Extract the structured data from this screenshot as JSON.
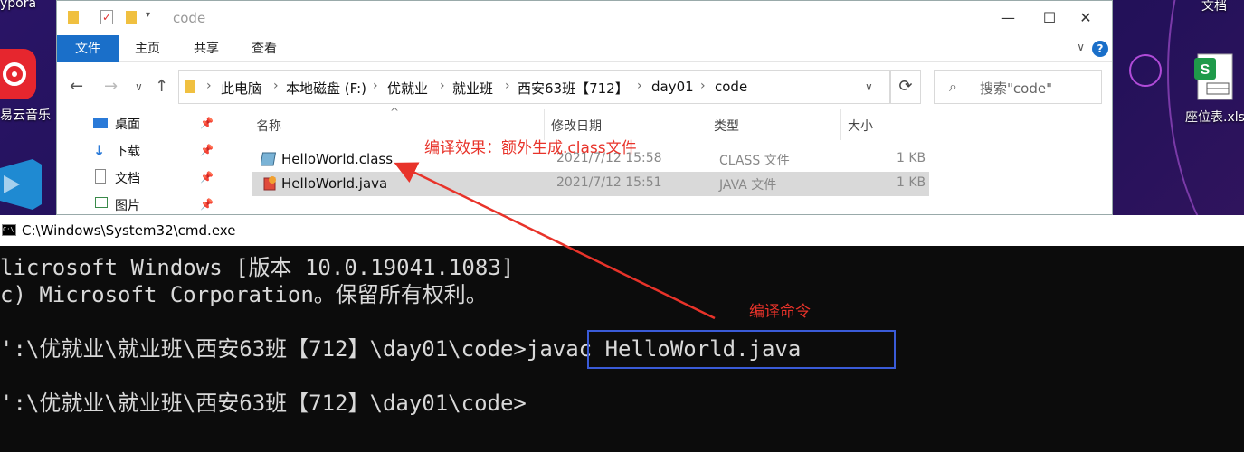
{
  "desktop": {
    "top_left_label": "ypora",
    "music_label": "易云音乐",
    "right_top_label": "文档",
    "sheet_label": "座位表.xls",
    "colors": {
      "accent_ring": "#b04bd8",
      "music_red": "#e6262e",
      "vscode_blue": "#1f8ad2"
    }
  },
  "explorer": {
    "window_title": "code",
    "ribbon": {
      "tabs": [
        "文件",
        "主页",
        "共享",
        "查看"
      ],
      "help": "?"
    },
    "breadcrumb": [
      "此电脑",
      "本地磁盘 (F:)",
      "优就业",
      "就业班",
      "西安63班【712】",
      "day01",
      "code"
    ],
    "search_placeholder": "搜索\"code\"",
    "nav_items": [
      "桌面",
      "下载",
      "文档",
      "图片"
    ],
    "columns": [
      "名称",
      "修改日期",
      "类型",
      "大小"
    ],
    "files": [
      {
        "name": "HelloWorld.class",
        "date": "2021/7/12 15:58",
        "type": "CLASS 文件",
        "size": "1 KB"
      },
      {
        "name": "HelloWorld.java",
        "date": "2021/7/12 15:51",
        "type": "JAVA 文件",
        "size": "1 KB"
      }
    ],
    "annotation": "编译效果：额外生成.class文件"
  },
  "cmd": {
    "title": "C:\\Windows\\System32\\cmd.exe",
    "lines": [
      "licrosoft Windows [版本 10.0.19041.1083]",
      "c) Microsoft Corporation。保留所有权利。",
      "",
      "':\\优就业\\就业班\\西安63班【712】\\day01\\code>javac HelloWorld.java",
      "",
      "':\\优就业\\就业班\\西安63班【712】\\day01\\code>"
    ],
    "annotation": "编译命令"
  }
}
